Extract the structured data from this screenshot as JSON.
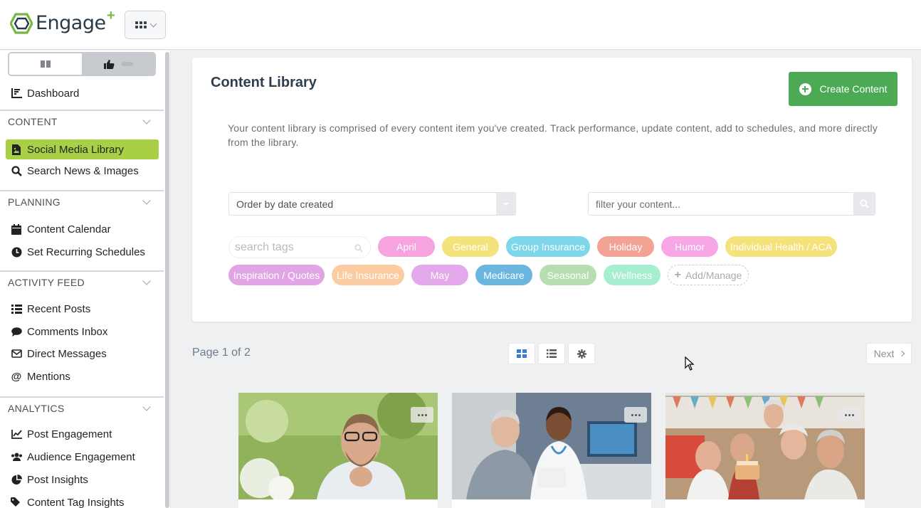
{
  "brand": {
    "name": "Engage",
    "plus": "+"
  },
  "sidebar": {
    "dashboard": "Dashboard",
    "sections": [
      {
        "title": "CONTENT",
        "items": [
          {
            "label": "Social Media Library",
            "icon": "file-image-icon",
            "active": true
          },
          {
            "label": "Search News & Images",
            "icon": "search-icon"
          }
        ]
      },
      {
        "title": "PLANNING",
        "items": [
          {
            "label": "Content Calendar",
            "icon": "calendar-icon"
          },
          {
            "label": "Set Recurring Schedules",
            "icon": "clock-icon"
          }
        ]
      },
      {
        "title": "ACTIVITY FEED",
        "items": [
          {
            "label": "Recent Posts",
            "icon": "list-icon"
          },
          {
            "label": "Comments Inbox",
            "icon": "comment-icon"
          },
          {
            "label": "Direct Messages",
            "icon": "envelope-icon"
          },
          {
            "label": "Mentions",
            "icon": "at-icon"
          }
        ]
      },
      {
        "title": "ANALYTICS",
        "items": [
          {
            "label": "Post Engagement",
            "icon": "line-chart-icon"
          },
          {
            "label": "Audience Engagement",
            "icon": "users-icon"
          },
          {
            "label": "Post Insights",
            "icon": "pie-chart-icon"
          },
          {
            "label": "Content Tag Insights",
            "icon": "tags-icon"
          }
        ]
      }
    ]
  },
  "library": {
    "title": "Content Library",
    "create_label": "Create Content",
    "description": "Your content library is comprised of every content item you've created. Track performance, update content, add to schedules, and more directly from the library.",
    "order_select": "Order by date created",
    "filter_placeholder": "filter your content...",
    "tag_search_placeholder": "search tags",
    "tags": [
      {
        "label": "April",
        "color": "#f6a3df"
      },
      {
        "label": "General",
        "color": "#f4e37a"
      },
      {
        "label": "Group Insurance",
        "color": "#7ed6ea"
      },
      {
        "label": "Holiday",
        "color": "#f2a394"
      },
      {
        "label": "Humor",
        "color": "#f7a7e6"
      },
      {
        "label": "Individual Health / ACA",
        "color": "#f5e27a"
      },
      {
        "label": "Inspiration / Quotes",
        "color": "#e1a5e5"
      },
      {
        "label": "Life Insurance",
        "color": "#fbcca2"
      },
      {
        "label": "May",
        "color": "#e4a9ea"
      },
      {
        "label": "Medicare",
        "color": "#6ab6df"
      },
      {
        "label": "Seasonal",
        "color": "#b6deb1"
      },
      {
        "label": "Wellness",
        "color": "#a5efcf"
      }
    ],
    "add_manage": "Add/Manage"
  },
  "pagination": {
    "page_label": "Page 1 of 2",
    "next": "Next"
  },
  "tiles": [
    {
      "alt": "man sneezing outdoors among blossoms"
    },
    {
      "alt": "doctor consulting senior patient"
    },
    {
      "alt": "seniors celebrating birthday with cake"
    }
  ]
}
